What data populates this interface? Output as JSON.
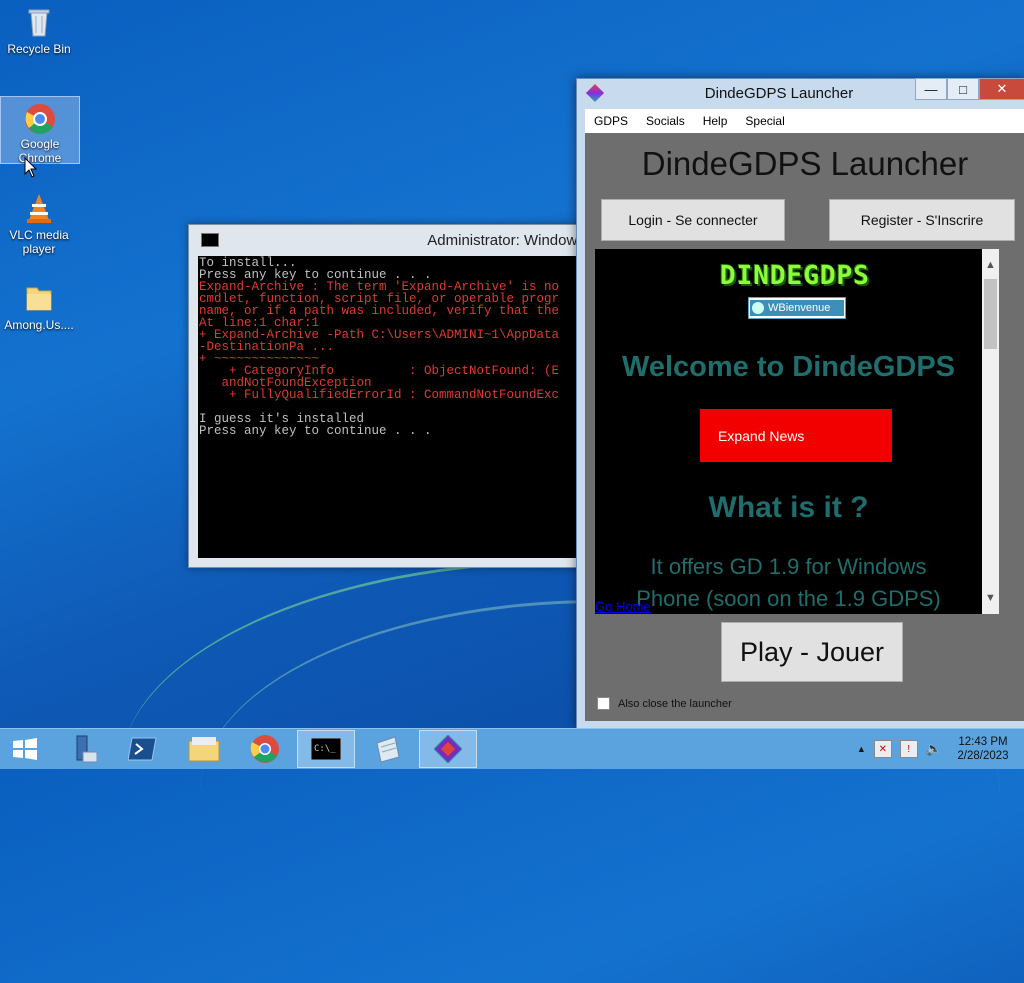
{
  "desktop": {
    "icons": [
      {
        "label": "Recycle Bin"
      },
      {
        "label": "Google Chrome"
      },
      {
        "label": "VLC media player"
      },
      {
        "label": "Among.Us...."
      }
    ]
  },
  "cmd": {
    "title": "Administrator: Windows P",
    "lines_normal_1": "To install...\nPress any key to continue . . .",
    "lines_error": "Expand-Archive : The term 'Expand-Archive' is no\ncmdlet, function, script file, or operable progr\nname, or if a path was included, verify that the\nAt line:1 char:1\n+ Expand-Archive -Path C:\\Users\\ADMINI~1\\AppData\n-DestinationPa ...\n+ ~~~~~~~~~~~~~~\n    + CategoryInfo          : ObjectNotFound: (E\n   andNotFoundException\n    + FullyQualifiedErrorId : CommandNotFoundExc",
    "lines_normal_2": "\nI guess it's installed\nPress any key to continue . . ."
  },
  "launcher": {
    "window_title": "DindeGDPS Launcher",
    "menu": [
      "GDPS",
      "Socials",
      "Help",
      "Special"
    ],
    "heading": "DindeGDPS Launcher",
    "login_label": "Login - Se connecter",
    "register_label": "Register - S'Inscrire",
    "web": {
      "logo_text": "DINDEGDPS",
      "badge_text": "WBienvenue",
      "welcome": "Welcome to DindeGDPS",
      "expand_label": "Expand News",
      "what_is_it": "What is it ?",
      "offers_line1": "It offers GD 1.9 for Windows",
      "offers_line2": "Phone (soon on the 1.9 GDPS)"
    },
    "go_home_label": "Go Home",
    "play_label": "Play - Jouer",
    "close_launcher_label": "Also close the launcher"
  },
  "taskbar": {
    "time": "12:43 PM",
    "date": "2/28/2023"
  },
  "colors": {
    "accent_teal": "#1f6d6d",
    "expand_red": "#f20000",
    "logo_green": "#8dfc3a",
    "cmd_error": "#e03a2f"
  }
}
